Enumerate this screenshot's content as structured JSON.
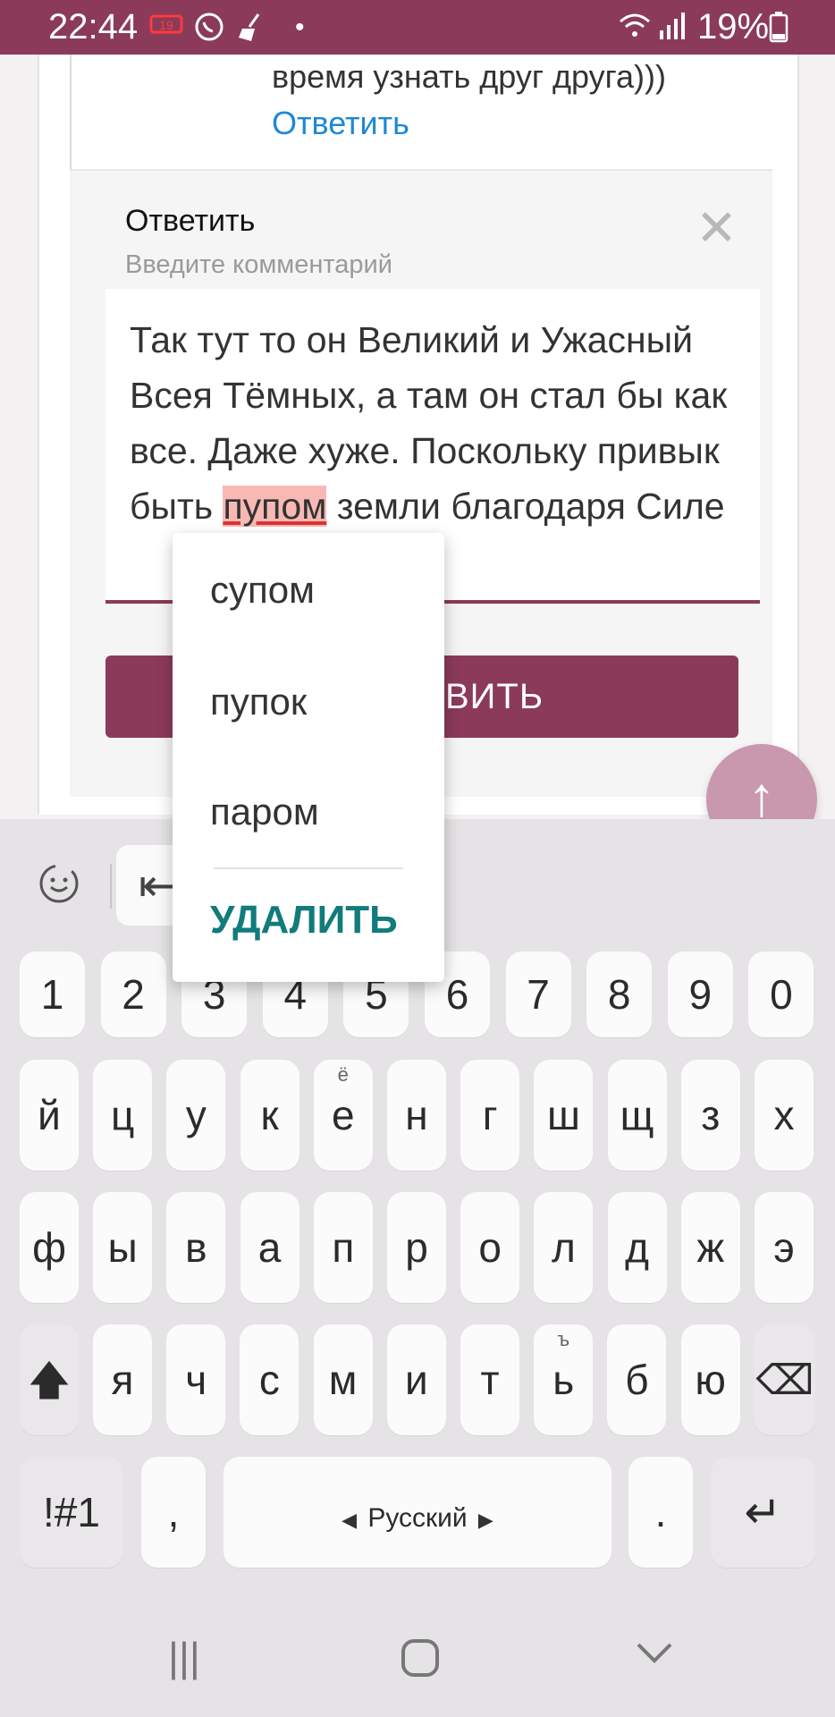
{
  "status_bar": {
    "time": "22:44",
    "battery_pct": "19%",
    "icons": [
      "carrier-icon",
      "whatsapp-icon",
      "broom-icon",
      "dot-icon",
      "wifi-icon",
      "signal-icon",
      "battery-icon"
    ]
  },
  "comment": {
    "text_tail": "время узнать друг друга)))",
    "reply_link": "Ответить"
  },
  "reply_form": {
    "title": "Ответить",
    "hint": "Введите комментарий",
    "text_before": "Так тут то он Великий и Ужасный Всея Тёмных, а там он стал бы как все. Даже хуже. Поскольку привык быть ",
    "text_error_word": "пупом",
    "text_after": " земли благодаря Силе",
    "submit_partial": "ВИТЬ"
  },
  "suggestions": {
    "items": [
      "супом",
      "пупок",
      "паром"
    ],
    "delete_label": "УДАЛИТЬ"
  },
  "keyboard": {
    "numbers": [
      "1",
      "2",
      "3",
      "4",
      "5",
      "6",
      "7",
      "8",
      "9",
      "0"
    ],
    "row1": [
      "й",
      "ц",
      "у",
      "к",
      "е",
      "н",
      "г",
      "ш",
      "щ",
      "з",
      "х"
    ],
    "row1_alt_e": "ё",
    "row2": [
      "ф",
      "ы",
      "в",
      "а",
      "п",
      "р",
      "о",
      "л",
      "д",
      "ж",
      "э"
    ],
    "row3": [
      "я",
      "ч",
      "с",
      "м",
      "и",
      "т",
      "ь",
      "б",
      "ю"
    ],
    "row3_alt_soft": "ъ",
    "symbols_label": "!#1",
    "comma": ",",
    "space_label": "Русский",
    "period": "."
  }
}
